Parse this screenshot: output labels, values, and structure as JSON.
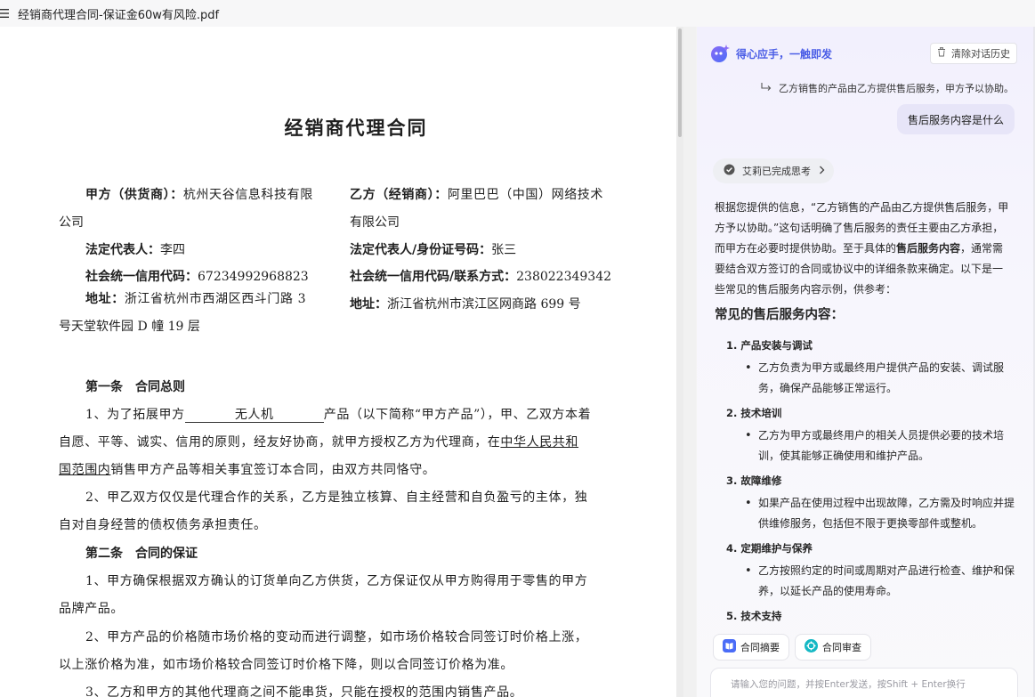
{
  "window": {
    "title": "经销商代理合同-保证金60w有风险.pdf"
  },
  "document": {
    "title": "经销商代理合同",
    "party_a": {
      "label": "甲方（供货商）：",
      "name_line1": "杭州天谷信息科技有限",
      "name_line2": "公司",
      "rep_label": "法定代表人：",
      "rep_value": "李四",
      "credit_label": "社会统一信用代码：",
      "credit_value": "67234992968823",
      "addr_label": "地址：",
      "addr_line1": "浙江省杭州市西湖区西斗门路 3",
      "addr_line2": "号天堂软件园 D 幢 19 层"
    },
    "party_b": {
      "label": "乙方（经销商）：",
      "name_line1": "阿里巴巴（中国）网络技术",
      "name_line2": "有限公司",
      "rep_label": "法定代表人/身份证号码：",
      "rep_value": "张三",
      "credit_label": "社会统一信用代码/联系方式：",
      "credit_value": "238022349342",
      "addr_label": "地址：",
      "addr_value": "浙江省杭州市滨江区网商路 699 号"
    },
    "article1": {
      "heading": "第一条　合同总则",
      "p1_a": "1、为了拓展甲方",
      "p1_blank": "无人机",
      "p1_b": "产品（以下简称“甲方产品”），甲、乙双方本着",
      "p1_line2_a": "自愿、平等、诚实、信用的原则，经友好协商，就甲方授权乙方为代理商，在",
      "p1_line2_u": "中华人民共和",
      "p1_line3_u": "国范围内",
      "p1_line3_b": "销售甲方产品等相关事宜签订本合同，由双方共同恪守。",
      "p2_line1": "2、甲乙双方仅仅是代理合作的关系，乙方是独立核算、自主经营和自负盈亏的主体，独",
      "p2_line2": "自对自身经营的债权债务承担责任。"
    },
    "article2": {
      "heading": "第二条　合同的保证",
      "p1_line1": "1、甲方确保根据双方确认的订货单向乙方供货，乙方保证仅从甲方购得用于零售的甲方",
      "p1_line2": "品牌产品。",
      "p2_line1": "2、甲方产品的价格随市场价格的变动而进行调整，如市场价格较合同签订时价格上涨，",
      "p2_line2": "以上涨价格为准，如市场价格较合同签订时价格下降，则以合同签订价格为准。",
      "p3_line1": "3、乙方和甲方的其他代理商之间不能串货，只能在授权的范围内销售产品。"
    }
  },
  "assistant": {
    "brand": "得心应手，一触即发",
    "clear_history": "清除对话历史",
    "quoted_text": "乙方销售的产品由乙方提供售后服务，甲方予以协助。",
    "user_message": "售后服务内容是什么",
    "thinking_status": "艾莉已完成思考",
    "answer": {
      "intro_1": "根据您提供的信息，“乙方销售的产品由乙方提供售后服务，甲方予以协助。”这句话明确了售后服务的责任主要由乙方承担，而甲方在必要时提供协助。至于具体的",
      "intro_bold": "售后服务内容",
      "intro_2": "，通常需要结合双方签订的合同或协议中的详细条款来确定。以下是一些常见的售后服务内容示例，供参考：",
      "heading": "常见的售后服务内容：",
      "items": [
        {
          "title": "1. 产品安装与调试",
          "desc": "乙方负责为甲方或最终用户提供产品的安装、调试服务，确保产品能够正常运行。"
        },
        {
          "title": "2. 技术培训",
          "desc": "乙方为甲方或最终用户的相关人员提供必要的技术培训，使其能够正确使用和维护产品。"
        },
        {
          "title": "3. 故障维修",
          "desc": "如果产品在使用过程中出现故障，乙方需及时响应并提供维修服务，包括但不限于更换零部件或整机。"
        },
        {
          "title": "4. 定期维护与保养",
          "desc": "乙方按照约定的时间或周期对产品进行检查、维护和保养，以延长产品的使用寿命。"
        },
        {
          "title": "5. 技术支持",
          "desc": ""
        }
      ]
    },
    "chips": [
      "合同摘要",
      "合同审查"
    ],
    "input_placeholder": "请输入您的问题，并按Enter发送，按Shift + Enter换行"
  },
  "colors": {
    "brand_blue": "#4a5de6",
    "user_bubble": "#e7e5f8",
    "chip_blue": "#4a6cf7",
    "chip_teal": "#14b8c4"
  }
}
